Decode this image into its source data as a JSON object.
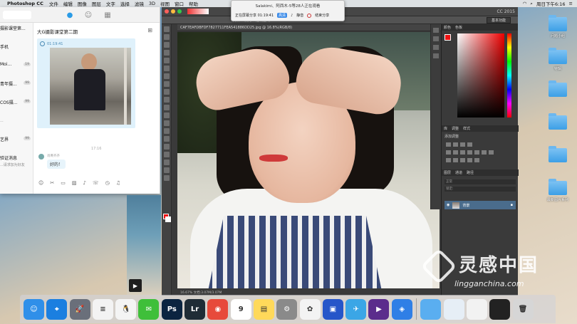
{
  "menubar": {
    "app_name": "Photoshop CC",
    "items": [
      "文件",
      "编辑",
      "图像",
      "图层",
      "文字",
      "选择",
      "滤镜",
      "3D",
      "视图",
      "窗口",
      "帮助"
    ],
    "clock": "周日下午6:16"
  },
  "chat": {
    "conversations": [
      {
        "title": "摄影课堂第...",
        "sub": "",
        "badge": ""
      },
      {
        "title": "手机",
        "sub": "",
        "badge": ""
      },
      {
        "title": "Moi...",
        "sub": "",
        "badge": "19"
      },
      {
        "title": "青年摄...",
        "sub": "...",
        "badge": "99"
      },
      {
        "title": "COS摄...",
        "sub": "...",
        "badge": "99"
      },
      {
        "title": "",
        "sub": "...",
        "badge": ""
      },
      {
        "title": "",
        "sub": "...",
        "badge": "99"
      },
      {
        "title": "艺界",
        "sub": "...",
        "badge": "99"
      },
      {
        "title": "验证消息",
        "sub": "...请求加为好友",
        "badge": ""
      }
    ],
    "current_title": "大G摄影课堂第二期",
    "message_time": "01:19:41",
    "image_timestamp": "17:16",
    "reply_name": "肖菁齐齐",
    "reply_text": "好的！"
  },
  "share": {
    "line1": "Salakimi、阿西木-5等28人正在观看",
    "status": "正在屏幕分享 01:19:41",
    "quality": "高清",
    "mute": "静音",
    "end": "结束分享"
  },
  "photoshop": {
    "title": "CC 2015",
    "doc_tab": "CAF7EAFDBFDF7827711FEA541886DD25.jpg @ 16.8%(RGB/8)",
    "options": [
      "对齐",
      "优先",
      "透明区域"
    ],
    "workspace": "基本功能",
    "status_bar": "16.67%  文档:3.07M/3.07M",
    "panel_color_tabs": [
      "颜色",
      "色板"
    ],
    "panel_adjust_tabs": [
      "库",
      "调整",
      "样式"
    ],
    "adjust_label": "添加调整",
    "panel_layer_tabs": [
      "图层",
      "通道",
      "路径"
    ],
    "layer_name": "背景",
    "layer_fields": [
      "正常",
      "锁定:"
    ]
  },
  "desktop_icons": [
    "问题小组",
    "特辑",
    "",
    "",
    "",
    "",
    "",
    "",
    "最新图片系列"
  ],
  "watermark": {
    "brand": "灵感中国",
    "url": "lingganchina.com"
  },
  "dock": {
    "apps": [
      {
        "name": "finder",
        "label": "☺",
        "color": "#2f8fe9"
      },
      {
        "name": "safari",
        "label": "⌖",
        "color": "#1b7fe0"
      },
      {
        "name": "launchpad",
        "label": "🚀",
        "color": "#6a6f7a"
      },
      {
        "name": "reminders",
        "label": "≡",
        "color": "#f3f3f3"
      },
      {
        "name": "qq",
        "label": "🐧",
        "color": "#f4f4f4"
      },
      {
        "name": "wechat",
        "label": "✉",
        "color": "#3fbf3a"
      },
      {
        "name": "photoshop",
        "label": "Ps",
        "color": "#0b2440"
      },
      {
        "name": "lightroom",
        "label": "Lr",
        "color": "#1f2c36"
      },
      {
        "name": "weibo",
        "label": "◉",
        "color": "#e74a3b"
      },
      {
        "name": "calendar",
        "label": "9",
        "color": "#ffffff"
      },
      {
        "name": "notes",
        "label": "▤",
        "color": "#ffd95a"
      },
      {
        "name": "system-prefs",
        "label": "⚙",
        "color": "#8a8a8a"
      },
      {
        "name": "photos",
        "label": "✿",
        "color": "#f3f3f3"
      },
      {
        "name": "video",
        "label": "▣",
        "color": "#2656c9"
      },
      {
        "name": "bird",
        "label": "✈",
        "color": "#3ba6e6"
      },
      {
        "name": "player",
        "label": "▶",
        "color": "#5b2c8c"
      },
      {
        "name": "baidu",
        "label": "◈",
        "color": "#2f7fe6"
      },
      {
        "name": "folder",
        "label": "",
        "color": "#5aaef0"
      },
      {
        "name": "stack1",
        "label": "",
        "color": "#e6eef6"
      },
      {
        "name": "stack2",
        "label": "",
        "color": "#f2f2f2"
      },
      {
        "name": "terminal",
        "label": "",
        "color": "#222"
      },
      {
        "name": "trash",
        "label": "🗑",
        "color": "#d6d6d6"
      }
    ]
  }
}
